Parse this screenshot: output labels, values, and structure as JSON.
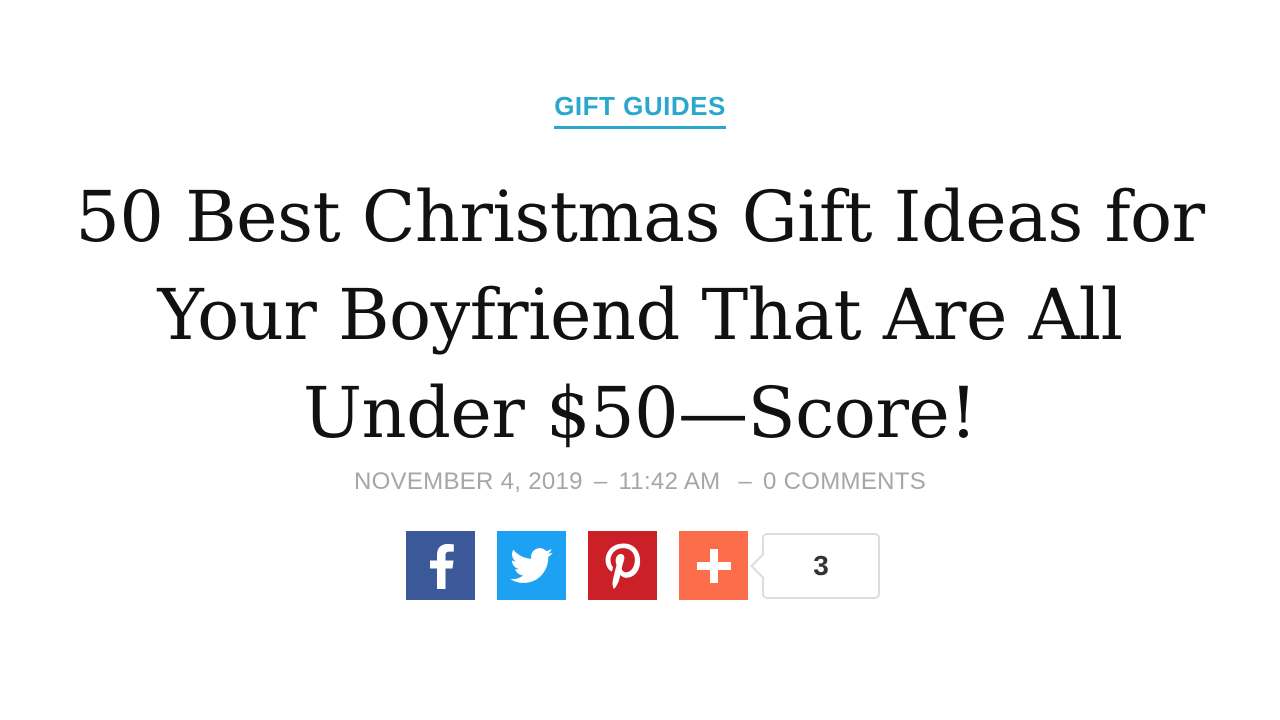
{
  "article": {
    "category": "GIFT GUIDES",
    "title": "50 Best Christmas Gift Ideas for Your Boyfriend That Are All Under $50—Score!",
    "date": "NOVEMBER 4, 2019",
    "time": "11:42 AM",
    "comments": "0 COMMENTS"
  },
  "share": {
    "buttons": [
      {
        "network": "facebook",
        "icon": "facebook-icon",
        "color": "#3b5998"
      },
      {
        "network": "twitter",
        "icon": "twitter-icon",
        "color": "#1da1f2"
      },
      {
        "network": "pinterest",
        "icon": "pinterest-icon",
        "color": "#cb2027"
      },
      {
        "network": "more",
        "icon": "plus-icon",
        "color": "#fc6d4c"
      }
    ],
    "count": "3"
  },
  "colors": {
    "accent": "#2aa8cc",
    "meta_text": "#a6a6a6",
    "headline_text": "#111111"
  }
}
